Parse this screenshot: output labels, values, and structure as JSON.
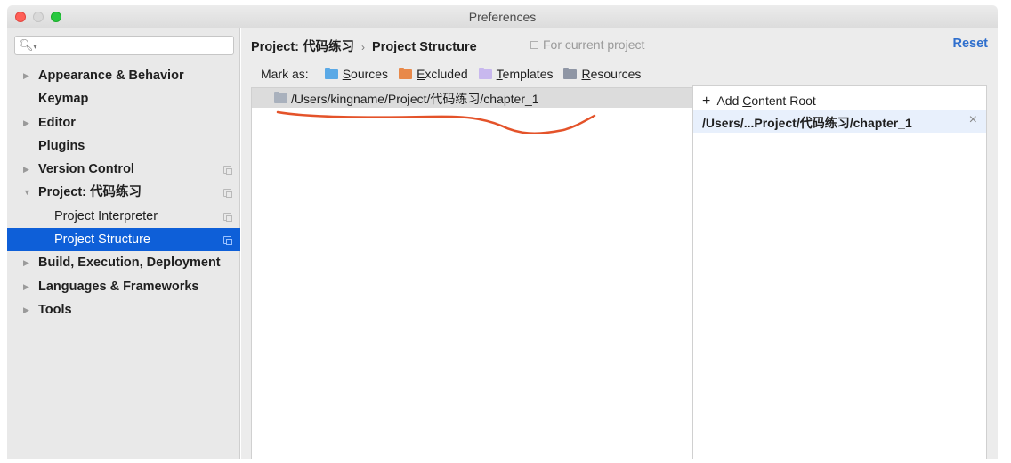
{
  "window": {
    "title": "Preferences"
  },
  "search": {
    "icon": "search-icon"
  },
  "sidebar": {
    "items": [
      {
        "label": "Appearance & Behavior",
        "expandable": true,
        "bold": true
      },
      {
        "label": "Keymap",
        "expandable": false,
        "bold": true
      },
      {
        "label": "Editor",
        "expandable": true,
        "bold": true
      },
      {
        "label": "Plugins",
        "expandable": false,
        "bold": true
      },
      {
        "label": "Version Control",
        "expandable": true,
        "bold": true,
        "project_scoped": true
      },
      {
        "label": "Project: 代码练习",
        "expandable": true,
        "expanded": true,
        "bold": true,
        "project_scoped": true
      },
      {
        "label": "Project Interpreter",
        "child": true,
        "project_scoped": true
      },
      {
        "label": "Project Structure",
        "child": true,
        "selected": true,
        "project_scoped": true
      },
      {
        "label": "Build, Execution, Deployment",
        "expandable": true,
        "bold": true
      },
      {
        "label": "Languages & Frameworks",
        "expandable": true,
        "bold": true
      },
      {
        "label": "Tools",
        "expandable": true,
        "bold": true
      }
    ]
  },
  "header": {
    "breadcrumb_project": "Project: 代码练习",
    "breadcrumb_separator": "›",
    "breadcrumb_page": "Project Structure",
    "scope_note": "For current project",
    "reset_label": "Reset"
  },
  "markas": {
    "label": "Mark as:",
    "options": [
      {
        "label": "Sources",
        "color": "#5aa9e6"
      },
      {
        "label": "Excluded",
        "color": "#e8894a"
      },
      {
        "label": "Templates",
        "color": "#c8b8ee"
      },
      {
        "label": "Resources",
        "color": "#8f96a5"
      }
    ]
  },
  "tree": {
    "root_path": "/Users/kingname/Project/代码练习/chapter_1",
    "folder_color": "#a9b1bd",
    "annotation_color": "#e4532a"
  },
  "content_roots": {
    "add_label": "+ Add Content Root",
    "roots": [
      "/Users/...Project/代码练习/chapter_1"
    ]
  },
  "colors": {
    "selection": "#0e5fd8",
    "link": "#2f6fcd"
  }
}
